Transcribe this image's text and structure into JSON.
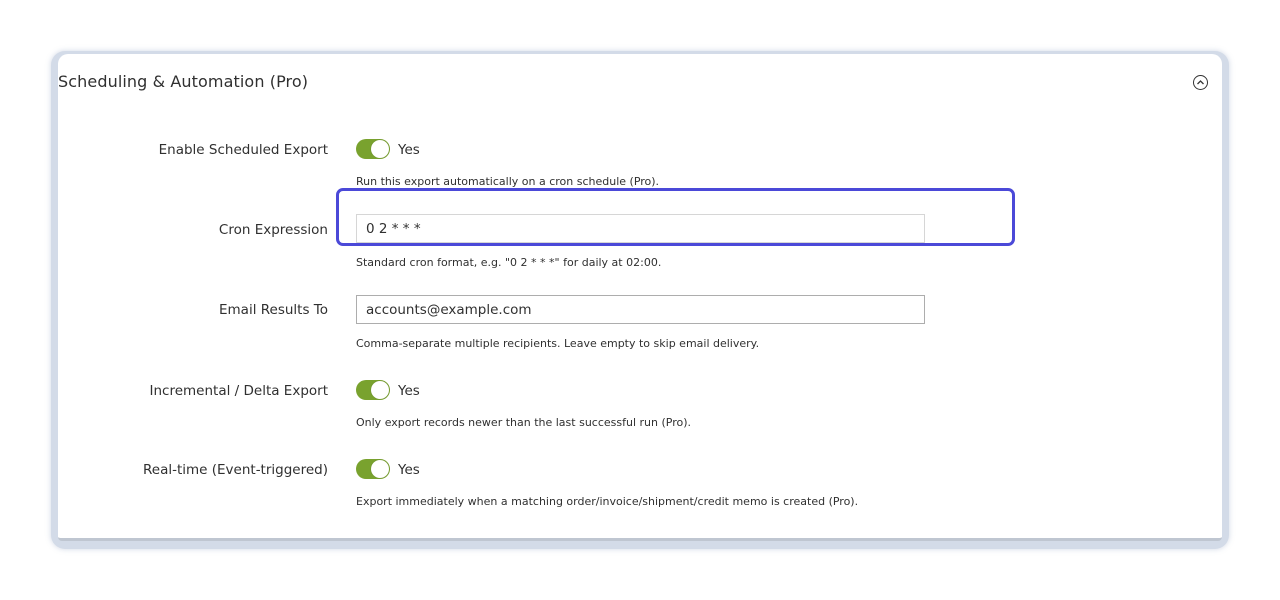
{
  "section": {
    "title": "Scheduling & Automation (Pro)",
    "collapse_icon": "chevron-up-circle-icon"
  },
  "fields": {
    "enable_scheduled_export": {
      "label": "Enable Scheduled Export",
      "value": "Yes",
      "note": "Run this export automatically on a cron schedule (Pro)."
    },
    "cron_expression": {
      "label": "Cron Expression",
      "value": "0 2 * * *",
      "note": "Standard cron format, e.g. \"0 2 * * *\" for daily at 02:00."
    },
    "email_results_to": {
      "label": "Email Results To",
      "value": "accounts@example.com",
      "note": "Comma-separate multiple recipients. Leave empty to skip email delivery."
    },
    "incremental_export": {
      "label": "Incremental / Delta Export",
      "value": "Yes",
      "note": "Only export records newer than the last successful run (Pro)."
    },
    "realtime_export": {
      "label": "Real-time (Event-triggered)",
      "value": "Yes",
      "note": "Export immediately when a matching order/invoice/shipment/credit memo is created (Pro)."
    }
  },
  "colors": {
    "toggle_on": "#79a22e",
    "highlight": "#4b49d8",
    "panel_frame": "#d3dbe8"
  }
}
